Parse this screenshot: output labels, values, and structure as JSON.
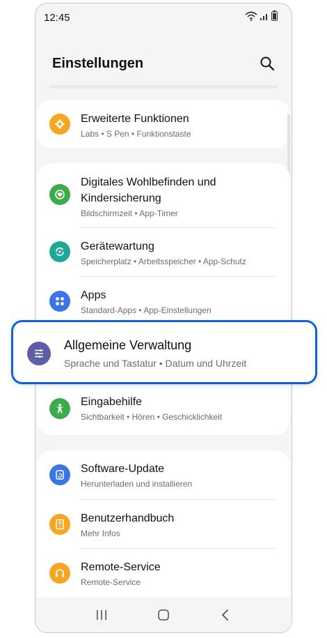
{
  "status_bar": {
    "time": "12:45"
  },
  "header": {
    "title": "Einstellungen"
  },
  "sections": [
    {
      "items": [
        {
          "title": "Erweiterte Funktionen",
          "subtitle": "Labs  •  S Pen  •  Funktionstaste",
          "icon": "gear-plus-icon",
          "color": "#f6a623"
        }
      ]
    },
    {
      "items": [
        {
          "title": "Digitales Wohlbefinden und Kindersicherung",
          "subtitle": "Bildschirmzeit  •  App-Timer",
          "icon": "heart-icon",
          "color": "#3bab4b"
        },
        {
          "title": "Gerätewartung",
          "subtitle": "Speicherplatz  •  Arbeitsspeicher  •  App-Schutz",
          "icon": "refresh-icon",
          "color": "#1fa893"
        },
        {
          "title": "Apps",
          "subtitle": "Standard-Apps  •  App-Einstellungen",
          "icon": "grid-icon",
          "color": "#3a74e6"
        },
        {
          "title": "Allgemeine Verwaltung",
          "subtitle": "Sprache und Tastatur  •  Datum und Uhrzeit",
          "icon": "sliders-icon",
          "color": "#5c5fa6",
          "highlighted": true
        },
        {
          "title": "Eingabehilfe",
          "subtitle": "Sichtbarkeit  •  Hören  •  Geschicklichkeit",
          "icon": "accessibility-icon",
          "color": "#3bab4b"
        }
      ]
    },
    {
      "items": [
        {
          "title": "Software-Update",
          "subtitle": "Herunterladen und installieren",
          "icon": "update-icon",
          "color": "#3a74e6"
        },
        {
          "title": "Benutzerhandbuch",
          "subtitle": "Mehr Infos",
          "icon": "manual-icon",
          "color": "#f6a623"
        },
        {
          "title": "Remote-Service",
          "subtitle": "Remote-Service",
          "icon": "headset-icon",
          "color": "#f6a623"
        }
      ]
    }
  ],
  "accent_color": "#1160d6"
}
